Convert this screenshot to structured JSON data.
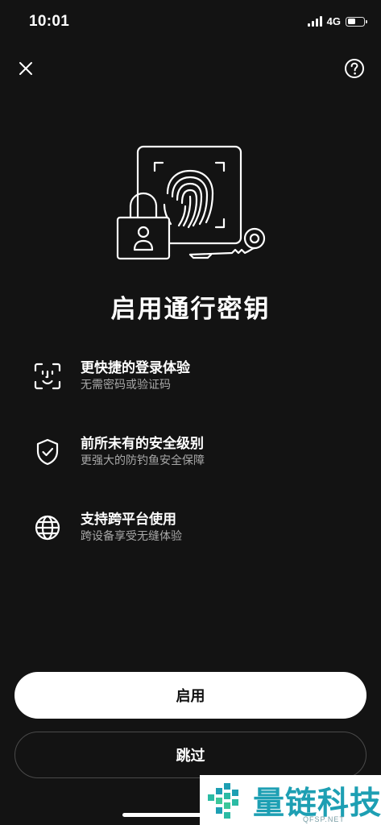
{
  "status_bar": {
    "time": "10:01",
    "network": "4G",
    "battery_level": 0.5
  },
  "header": {
    "close_icon": "close-icon",
    "help_icon": "help-icon"
  },
  "hero": {
    "icon": "passkey-illustration"
  },
  "title": "启用通行密钥",
  "features": [
    {
      "icon": "face-id-icon",
      "title": "更快捷的登录体验",
      "desc": "无需密码或验证码"
    },
    {
      "icon": "shield-check-icon",
      "title": "前所未有的安全级别",
      "desc": "更强大的防钓鱼安全保障"
    },
    {
      "icon": "globe-icon",
      "title": "支持跨平台使用",
      "desc": "跨设备享受无缝体验"
    }
  ],
  "buttons": {
    "enable_label": "启用",
    "skip_label": "跳过"
  },
  "watermark": {
    "text": "量链科技",
    "sub": "QFSP.NET"
  },
  "colors": {
    "background": "#131313",
    "primary_button": "#ffffff",
    "secondary_text": "#a8a8a8",
    "watermark_accent": "#1d9fb3"
  }
}
